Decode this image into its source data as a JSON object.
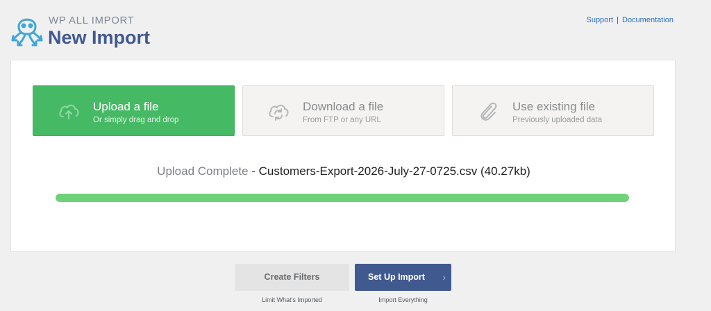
{
  "header": {
    "brand_small": "WP ALL IMPORT",
    "title": "New Import",
    "links": {
      "support": "Support",
      "separator": "|",
      "documentation": "Documentation"
    }
  },
  "tiles": [
    {
      "title": "Upload a file",
      "subtitle": "Or simply drag and drop",
      "icon": "cloud-upload-icon",
      "active": true
    },
    {
      "title": "Download a file",
      "subtitle": "From FTP or any URL",
      "icon": "cloud-sync-icon",
      "active": false
    },
    {
      "title": "Use existing file",
      "subtitle": "Previously uploaded data",
      "icon": "paperclip-icon",
      "active": false
    }
  ],
  "upload_status": {
    "label": "Upload Complete",
    "separator": " - ",
    "filename": "Customers-Export-2026-July-27-0725.csv",
    "size": "(40.27kb)",
    "progress_fraction": 1.0
  },
  "actions": {
    "filters_label": "Create Filters",
    "filters_caption": "Limit What's Imported",
    "import_label": "Set Up Import",
    "import_chevron": "›",
    "import_caption": "Import Everything"
  },
  "colors": {
    "brand": "#40598f",
    "accent_green": "#46b964",
    "progress": "#6fd27a",
    "link": "#2a6fc0",
    "logo": "#3fa7d6"
  }
}
